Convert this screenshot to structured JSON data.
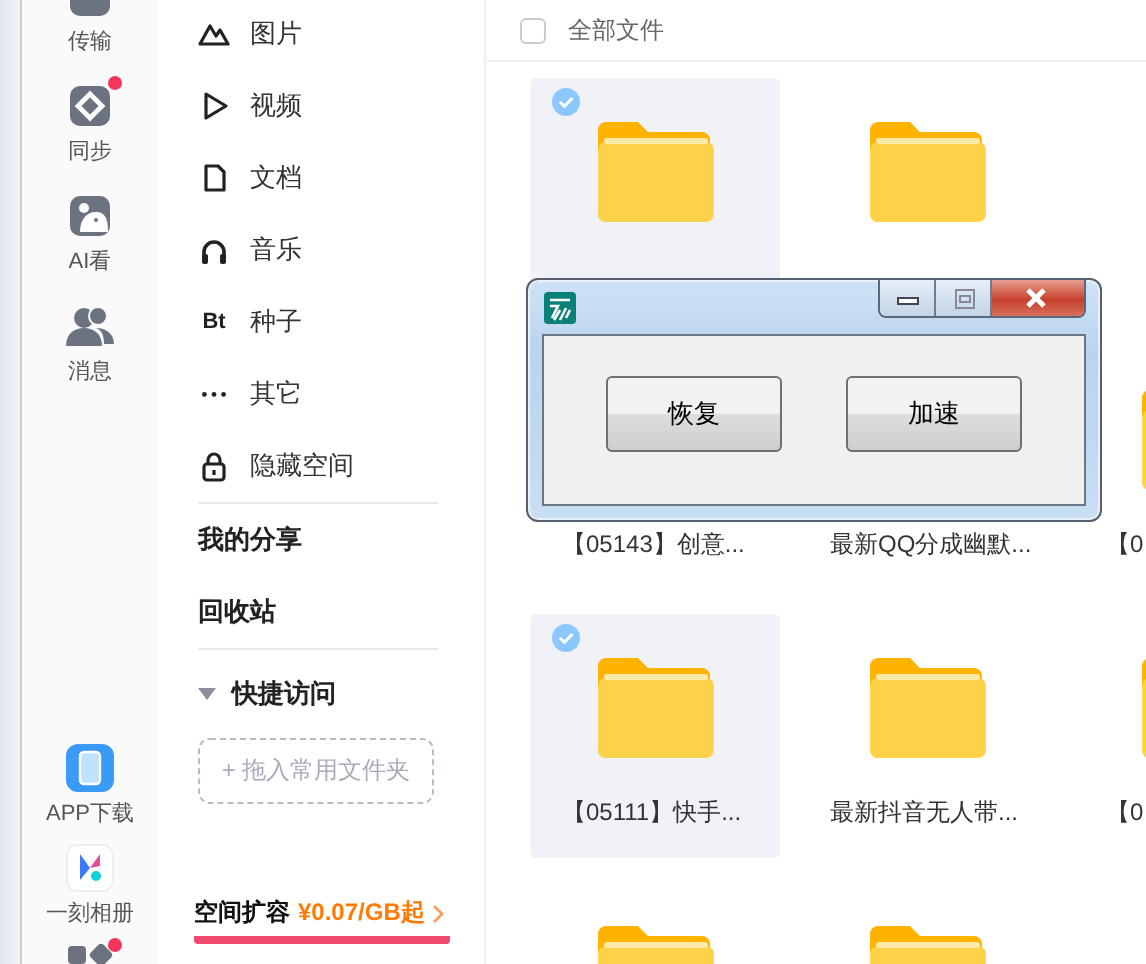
{
  "rail": {
    "items": [
      {
        "label": "传输",
        "badge": false
      },
      {
        "label": "同步",
        "badge": true
      },
      {
        "label": "AI看",
        "badge": false
      },
      {
        "label": "消息",
        "badge": false
      }
    ],
    "bottom_items": [
      {
        "label": "APP下载",
        "badge": false
      },
      {
        "label": "一刻相册",
        "badge": false
      },
      {
        "badge": true
      }
    ]
  },
  "nav": {
    "categories": [
      {
        "label": "图片"
      },
      {
        "label": "视频"
      },
      {
        "label": "文档"
      },
      {
        "label": "音乐"
      },
      {
        "label": "种子",
        "icon_text": "Bt"
      },
      {
        "label": "其它"
      },
      {
        "label": "隐藏空间"
      }
    ],
    "sections": [
      {
        "label": "我的分享"
      },
      {
        "label": "回收站"
      }
    ],
    "quick_access": {
      "label": "快捷访问",
      "expanded": true,
      "drop_placeholder": "+ 拖入常用文件夹"
    },
    "promo": {
      "label": "空间扩容",
      "price": "¥0.07/GB起"
    }
  },
  "files": {
    "header": {
      "label": "全部文件",
      "checked": false
    },
    "rows": [
      [
        {
          "selected": true
        },
        {
          "selected": false
        }
      ],
      [
        {
          "label": "【05143】创意...",
          "selected": false
        },
        {
          "label": "最新QQ分成幽默...",
          "selected": false
        },
        {
          "label": "【0",
          "selected": false
        }
      ],
      [
        {
          "label": "【05111】快手...",
          "selected": true
        },
        {
          "label": "最新抖音无人带...",
          "selected": false
        },
        {
          "label": "【0",
          "selected": false
        }
      ],
      [
        {
          "selected": false
        },
        {
          "selected": false
        }
      ]
    ]
  },
  "dialog": {
    "buttons": [
      "恢复",
      "加速"
    ]
  }
}
